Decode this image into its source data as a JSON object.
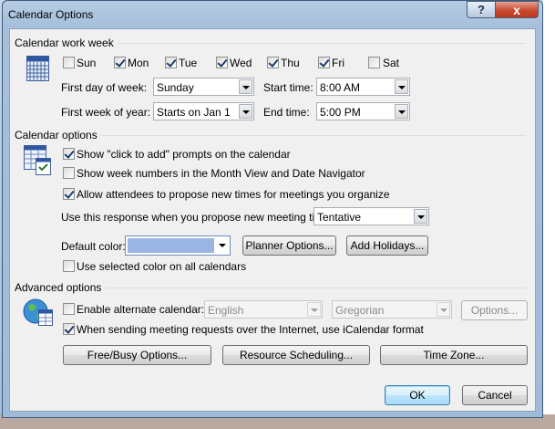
{
  "window": {
    "title": "Calendar Options",
    "help_label": "?",
    "close_label": "x"
  },
  "work_week": {
    "section_title": "Calendar work week",
    "days": [
      {
        "label": "Sun",
        "checked": false
      },
      {
        "label": "Mon",
        "checked": true
      },
      {
        "label": "Tue",
        "checked": true
      },
      {
        "label": "Wed",
        "checked": true
      },
      {
        "label": "Thu",
        "checked": true
      },
      {
        "label": "Fri",
        "checked": true
      },
      {
        "label": "Sat",
        "checked": false
      }
    ],
    "first_day_label": "First day of week:",
    "first_day_value": "Sunday",
    "first_week_label": "First week of year:",
    "first_week_value": "Starts on Jan 1",
    "start_time_label": "Start time:",
    "start_time_value": "8:00 AM",
    "end_time_label": "End time:",
    "end_time_value": "5:00 PM",
    "icon": "calendar-grid-icon"
  },
  "calendar_options": {
    "section_title": "Calendar options",
    "icon": "calendar-settings-icon",
    "checks": [
      {
        "label": "Show \"click to add\" prompts on the calendar",
        "checked": true
      },
      {
        "label": "Show week numbers in the Month View and Date Navigator",
        "checked": false
      },
      {
        "label": "Allow attendees to propose new times for meetings you organize",
        "checked": true
      }
    ],
    "response_label": "Use this response when you propose new meeting times:",
    "response_value": "Tentative",
    "default_color_label": "Default color:",
    "default_color_value": "#9ab5e2",
    "planner_button": "Planner Options...",
    "holidays_button": "Add Holidays...",
    "use_color_label": "Use selected color on all calendars",
    "use_color_checked": false
  },
  "advanced": {
    "section_title": "Advanced options",
    "icon": "globe-calendar-icon",
    "alt_cal_label": "Enable alternate calendar:",
    "alt_cal_checked": false,
    "language_value": "English",
    "calendar_type_value": "Gregorian",
    "options_button": "Options...",
    "icalendar_label": "When sending meeting requests over the Internet, use iCalendar format",
    "icalendar_checked": true,
    "freebusy_button": "Free/Busy Options...",
    "resource_button": "Resource Scheduling...",
    "timezone_button": "Time Zone..."
  },
  "footer": {
    "ok_label": "OK",
    "cancel_label": "Cancel"
  }
}
